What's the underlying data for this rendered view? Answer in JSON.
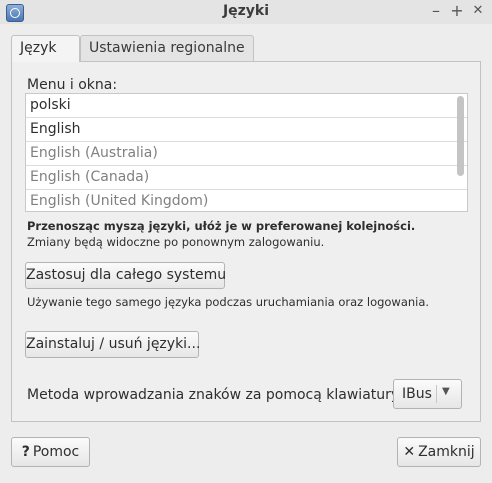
{
  "window": {
    "title": "Języki",
    "minimize": "–",
    "maximize": "+",
    "close": "✕"
  },
  "tabs": [
    {
      "label": "Język",
      "active": true
    },
    {
      "label": "Ustawienia regionalne",
      "active": false
    }
  ],
  "language": {
    "section_label": "Menu i okna:",
    "items": [
      {
        "label": "polski",
        "installed": true
      },
      {
        "label": "English",
        "installed": true
      },
      {
        "label": "English (Australia)",
        "installed": false
      },
      {
        "label": "English (Canada)",
        "installed": false
      },
      {
        "label": "English (United Kingdom)",
        "installed": false
      }
    ],
    "hint_bold": "Przenosząc myszą języki, ułóż je w preferowanej kolejności.",
    "hint": "Zmiany będą widoczne po ponownym zalogowaniu.",
    "apply_button": "Zastosuj dla całego systemu",
    "apply_desc": "Używanie tego samego języka podczas uruchamiania oraz logowania.",
    "install_button": "Zainstaluj / usuń języki...",
    "input_method_label": "Metoda wprowadzania znaków za pomocą klawiatury:",
    "input_method_value": "IBus"
  },
  "footer": {
    "help_icon": "?",
    "help_label": "Pomoc",
    "close_icon": "✕",
    "close_label": "Zamknij"
  }
}
